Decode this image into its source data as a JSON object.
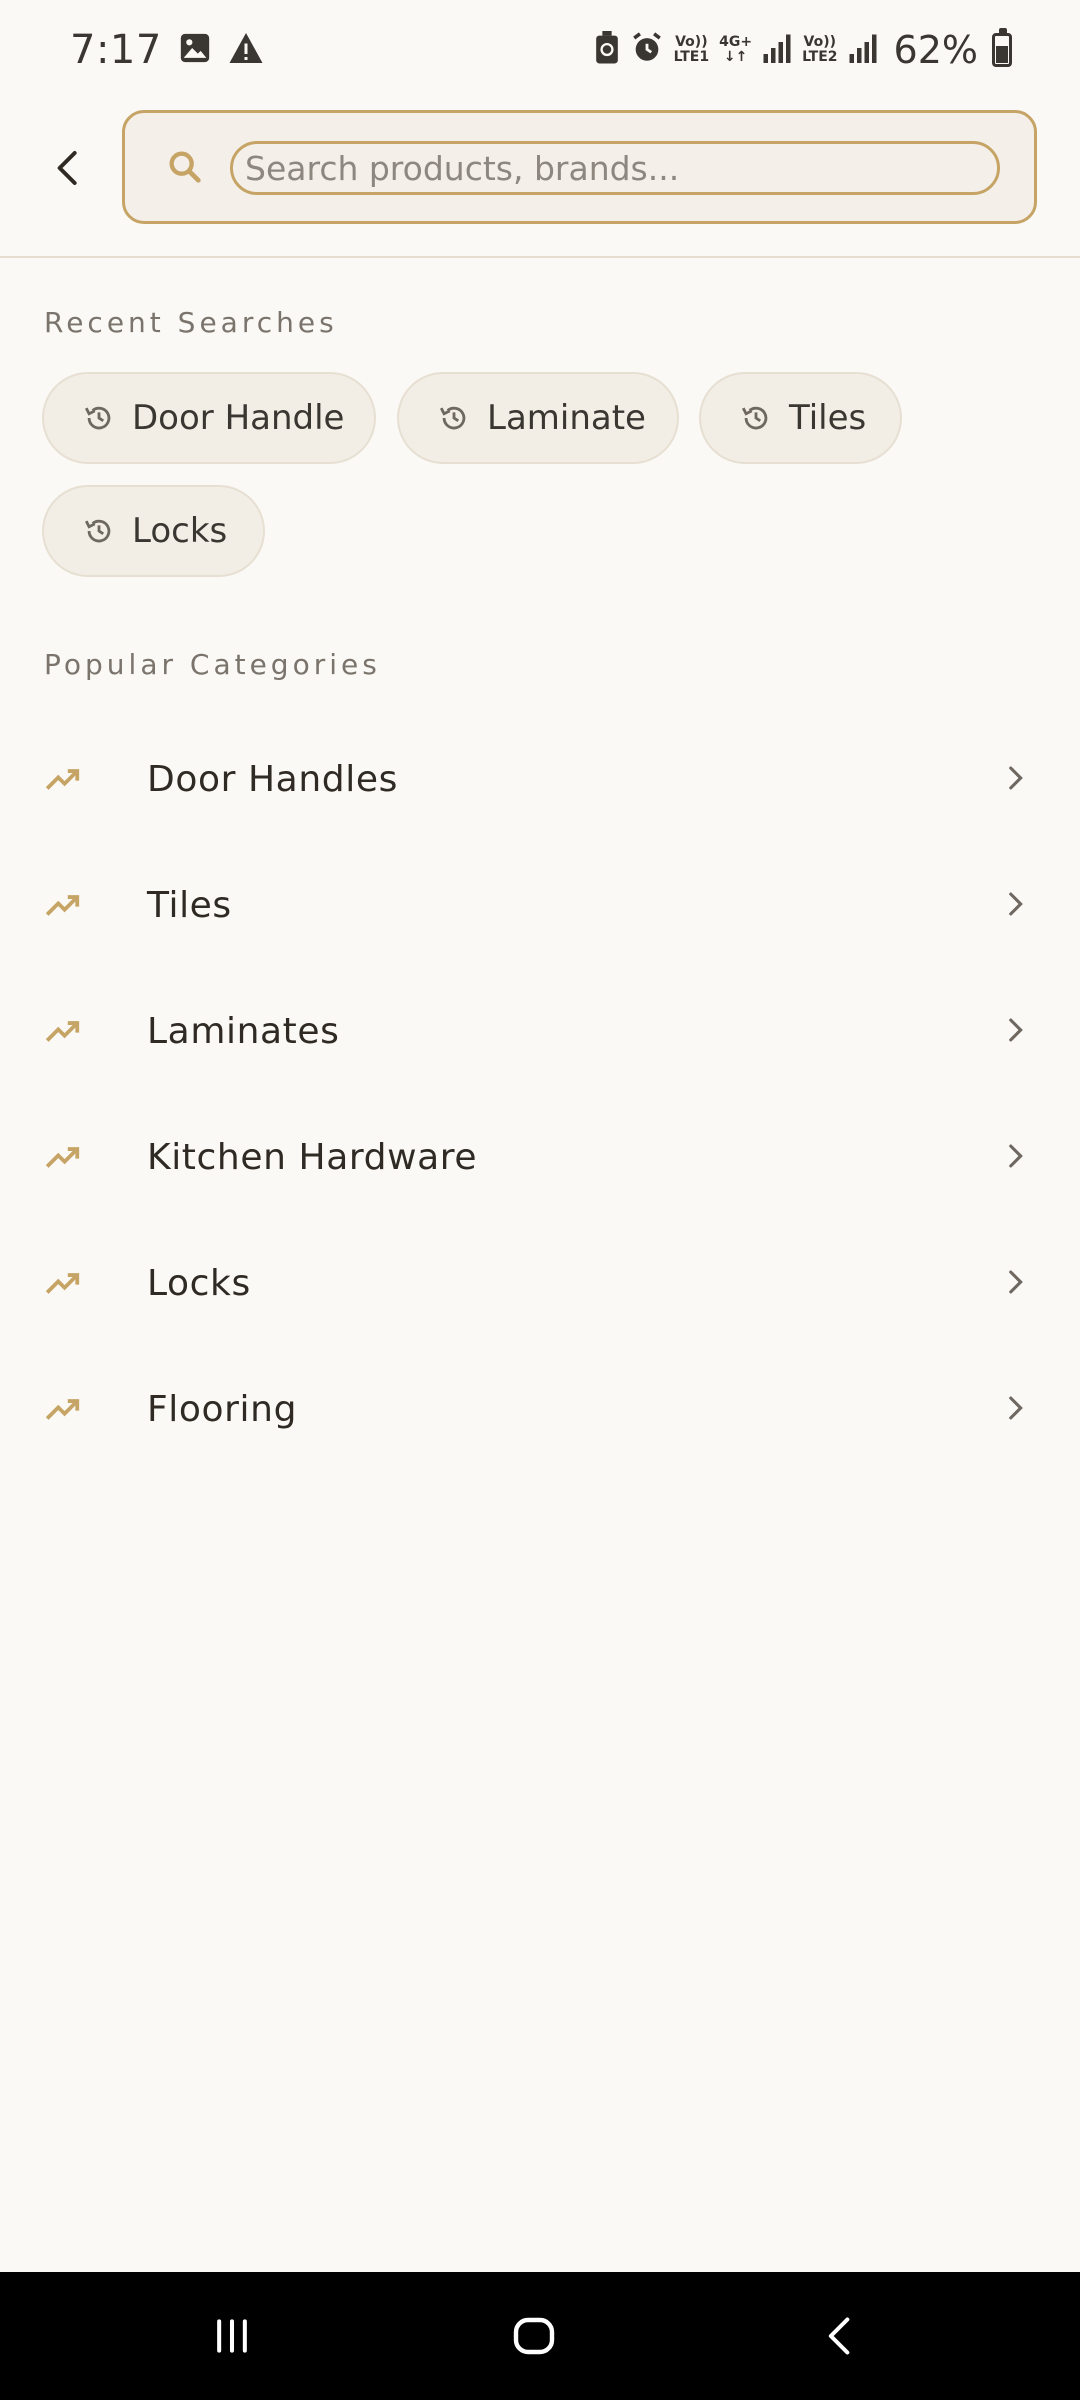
{
  "status_bar": {
    "time": "7:17",
    "battery": "62%",
    "battery_level": 0.62,
    "icons": [
      "gallery-icon",
      "warning-icon",
      "battery-saver-icon",
      "alarm-icon",
      "volte1-icon",
      "4g-data-icon",
      "signal-icon",
      "volte2-icon",
      "signal-icon",
      "battery-icon"
    ],
    "net": {
      "volte1_top": "Vo))",
      "volte1_bottom": "LTE1",
      "data_top": "4G+",
      "data_bottom": "↓↑",
      "volte2_top": "Vo))",
      "volte2_bottom": "LTE2"
    }
  },
  "header": {
    "back_icon": "back-arrow-icon",
    "search": {
      "placeholder": "Search products, brands...",
      "value": "",
      "icon": "search-icon"
    }
  },
  "recent": {
    "title": "Recent Searches",
    "items": [
      "Door Handle",
      "Laminate",
      "Tiles",
      "Locks"
    ],
    "icon": "history-icon"
  },
  "popular": {
    "title": "Popular Categories",
    "items": [
      "Door Handles",
      "Tiles",
      "Laminates",
      "Kitchen Hardware",
      "Locks",
      "Flooring"
    ],
    "icon": "trending-icon"
  },
  "nav": {
    "icons": [
      "recent-apps-icon",
      "home-icon",
      "back-icon"
    ]
  },
  "colors": {
    "accent": "#c6a466",
    "background": "#fbf9f5",
    "chip_bg": "#f2eee6",
    "text": "#2f2a24",
    "muted": "#7a746c"
  }
}
